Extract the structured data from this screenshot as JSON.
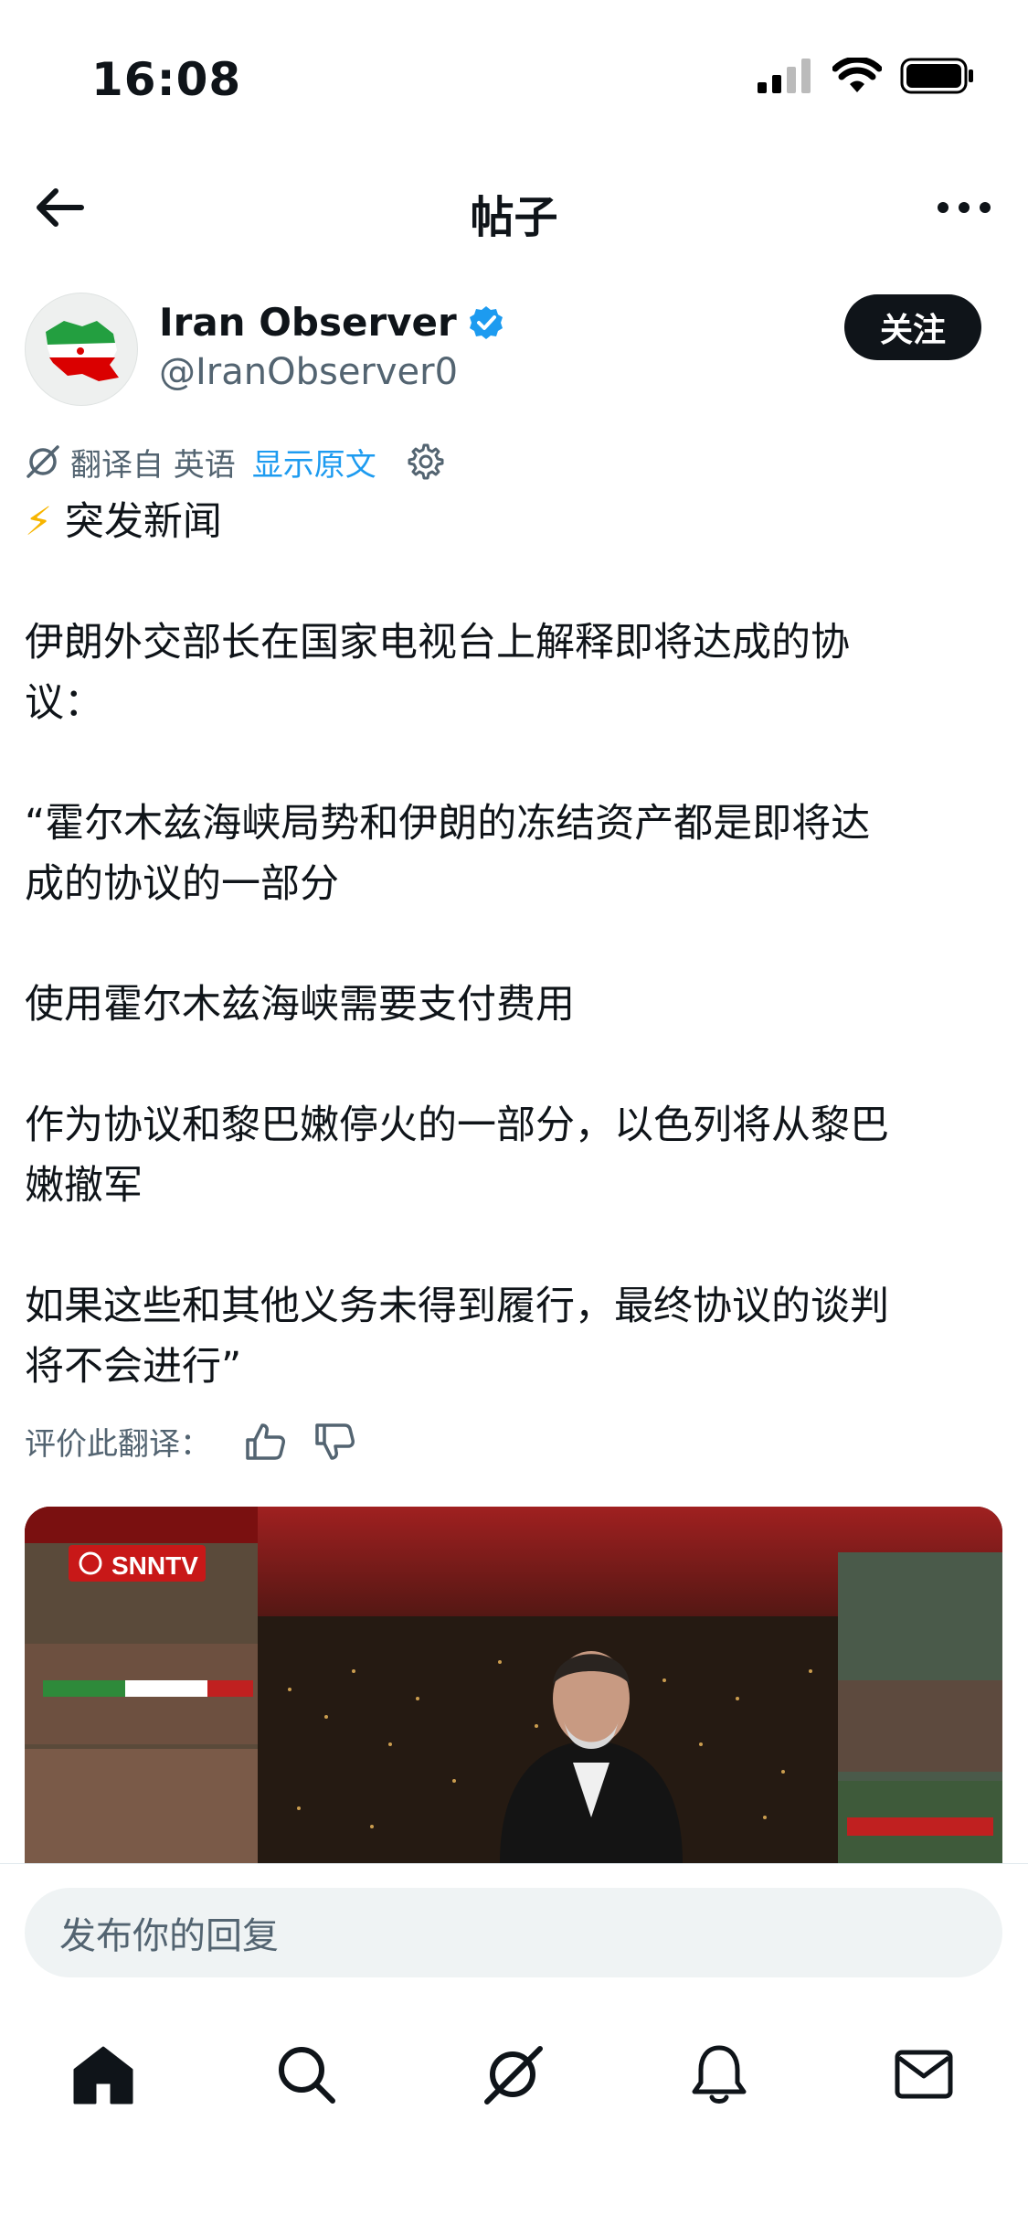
{
  "status_bar": {
    "time": "16:08"
  },
  "header": {
    "title": "帖子"
  },
  "author": {
    "name": "Iran Observer",
    "handle": "@IranObserver0",
    "follow_label": "关注"
  },
  "translation": {
    "label": "翻译自 英语",
    "show_original": "显示原文"
  },
  "post": {
    "headline": "突发新闻",
    "paragraphs": [
      [
        "伊朗外交部长在国家电视台上解释即将达成的协",
        "议："
      ],
      [
        "“霍尔木兹海峡局势和伊朗的冻结资产都是即将达",
        "成的协议的一部分"
      ],
      [
        "使用霍尔木兹海峡需要支付费用"
      ],
      [
        "作为协议和黎巴嫩停火的一部分，以色列将从黎巴",
        "嫩撤军"
      ],
      [
        "如果这些和其他义务未得到履行，最终协议的谈判",
        "将不会进行”"
      ]
    ]
  },
  "rate_translation": {
    "label": "评价此翻译："
  },
  "media": {
    "channel_label": "SNNTV"
  },
  "reply": {
    "placeholder": "发布你的回复"
  },
  "tabs": [
    "home-icon",
    "search-icon",
    "grok-icon",
    "notifications-icon",
    "messages-icon"
  ],
  "colors": {
    "accent": "#1d9bf0",
    "text": "#0f1419",
    "secondary": "#536471",
    "follow_bg": "#0f1419"
  }
}
